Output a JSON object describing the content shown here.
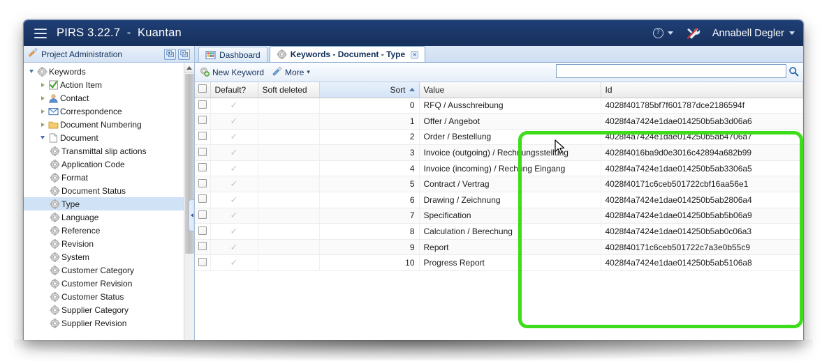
{
  "window": {
    "title_bar": {
      "menu_icon": "hamburger-icon",
      "app_title": "PIRS 3.22.7  -  Kuantan",
      "help_icon": "?",
      "tools_icon": "wrench-icon",
      "user_name": "Annabell Degler"
    }
  },
  "sidebar": {
    "header_title": "Project Administration",
    "header_buttons": [
      {
        "name": "expand-all-button",
        "icon": "expand-icon"
      },
      {
        "name": "collapse-all-button",
        "icon": "collapse-icon"
      }
    ],
    "tree": [
      {
        "label": "Keywords",
        "indent": 0,
        "twisty": "down",
        "icon": "gear-icon",
        "selected": false
      },
      {
        "label": "Action Item",
        "indent": 1,
        "twisty": "right",
        "icon": "check-icon",
        "selected": false
      },
      {
        "label": "Contact",
        "indent": 1,
        "twisty": "right",
        "icon": "contact-icon",
        "selected": false
      },
      {
        "label": "Correspondence",
        "indent": 1,
        "twisty": "right",
        "icon": "envelope-icon",
        "selected": false
      },
      {
        "label": "Document Numbering",
        "indent": 1,
        "twisty": "right",
        "icon": "folder-icon",
        "selected": false
      },
      {
        "label": "Document",
        "indent": 1,
        "twisty": "down",
        "icon": "page-icon",
        "selected": false
      },
      {
        "label": "Transmittal slip actions",
        "indent": 2,
        "twisty": "none",
        "icon": "gear-icon",
        "selected": false
      },
      {
        "label": "Application Code",
        "indent": 2,
        "twisty": "none",
        "icon": "gear-icon",
        "selected": false
      },
      {
        "label": "Format",
        "indent": 2,
        "twisty": "none",
        "icon": "gear-icon",
        "selected": false
      },
      {
        "label": "Document Status",
        "indent": 2,
        "twisty": "none",
        "icon": "gear-icon",
        "selected": false
      },
      {
        "label": "Type",
        "indent": 2,
        "twisty": "none",
        "icon": "gear-icon",
        "selected": true
      },
      {
        "label": "Language",
        "indent": 2,
        "twisty": "none",
        "icon": "gear-icon",
        "selected": false
      },
      {
        "label": "Reference",
        "indent": 2,
        "twisty": "none",
        "icon": "gear-icon",
        "selected": false
      },
      {
        "label": "Revision",
        "indent": 2,
        "twisty": "none",
        "icon": "gear-icon",
        "selected": false
      },
      {
        "label": "System",
        "indent": 2,
        "twisty": "none",
        "icon": "gear-icon",
        "selected": false
      },
      {
        "label": "Customer Category",
        "indent": 2,
        "twisty": "none",
        "icon": "gear-icon",
        "selected": false
      },
      {
        "label": "Customer Revision",
        "indent": 2,
        "twisty": "none",
        "icon": "gear-icon",
        "selected": false
      },
      {
        "label": "Customer Status",
        "indent": 2,
        "twisty": "none",
        "icon": "gear-icon",
        "selected": false
      },
      {
        "label": "Supplier Category",
        "indent": 2,
        "twisty": "none",
        "icon": "gear-icon",
        "selected": false
      },
      {
        "label": "Supplier Revision",
        "indent": 2,
        "twisty": "none",
        "icon": "gear-icon",
        "selected": false
      }
    ]
  },
  "tabs": [
    {
      "label": "Dashboard",
      "icon": "dashboard-icon",
      "active": false,
      "closable": false
    },
    {
      "label": "Keywords - Document - Type",
      "icon": "gear-icon",
      "active": true,
      "closable": true,
      "close_glyph": "×"
    }
  ],
  "toolbar": {
    "new_keyword_label": "New Keyword",
    "more_label": "More",
    "more_caret": "▾"
  },
  "search": {
    "value": "",
    "placeholder": "",
    "icon": "search-icon"
  },
  "grid": {
    "columns": [
      {
        "key": "checkbox",
        "label": "",
        "sorted": false,
        "align": "left"
      },
      {
        "key": "default",
        "label": "Default?",
        "sorted": false,
        "align": "left"
      },
      {
        "key": "softdeleted",
        "label": "Soft deleted",
        "sorted": false,
        "align": "left"
      },
      {
        "key": "sort",
        "label": "Sort",
        "sorted": true,
        "align": "right",
        "sort_dir": "asc"
      },
      {
        "key": "value",
        "label": "Value",
        "sorted": false,
        "align": "left"
      },
      {
        "key": "id",
        "label": "Id",
        "sorted": false,
        "align": "left"
      }
    ],
    "check_glyph": "✓",
    "rows": [
      {
        "sort": "0",
        "value": "RFQ / Ausschreibung",
        "id": "4028f401785bf7f601787dce2186594f",
        "default": true,
        "soft_deleted": ""
      },
      {
        "sort": "1",
        "value": "Offer / Angebot",
        "id": "4028f4a7424e1dae014250b5ab3d06a6",
        "default": true,
        "soft_deleted": ""
      },
      {
        "sort": "2",
        "value": "Order / Bestellung",
        "id": "4028f4a7424e1dae014250b5ab4706a7",
        "default": true,
        "soft_deleted": ""
      },
      {
        "sort": "3",
        "value": "Invoice (outgoing) / Rechnungsstellung",
        "id": "4028f4016ba9d0e3016c42894a682b99",
        "default": true,
        "soft_deleted": ""
      },
      {
        "sort": "4",
        "value": "Invoice (incoming) / Rechung Eingang",
        "id": "4028f4a7424e1dae014250b5ab3306a5",
        "default": true,
        "soft_deleted": ""
      },
      {
        "sort": "5",
        "value": "Contract / Vertrag",
        "id": "4028f40171c6ceb501722cbf16aa56e1",
        "default": true,
        "soft_deleted": ""
      },
      {
        "sort": "6",
        "value": "Drawing / Zeichnung",
        "id": "4028f4a7424e1dae014250b5ab2806a4",
        "default": true,
        "soft_deleted": ""
      },
      {
        "sort": "7",
        "value": "Specification",
        "id": "4028f4a7424e1dae014250b5ab5b06a9",
        "default": true,
        "soft_deleted": ""
      },
      {
        "sort": "8",
        "value": "Calculation / Berechung",
        "id": "4028f4a7424e1dae014250b5ab0c06a3",
        "default": true,
        "soft_deleted": ""
      },
      {
        "sort": "9",
        "value": "Report",
        "id": "4028f40171c6ceb501722c7a3e0b55c9",
        "default": true,
        "soft_deleted": ""
      },
      {
        "sort": "10",
        "value": "Progress Report",
        "id": "4028f4a7424e1dae014250b5ab5106a8",
        "default": true,
        "soft_deleted": ""
      }
    ]
  },
  "annotation": {
    "highlight_color": "#3ddd1b",
    "shape": "rounded-rectangle"
  },
  "colors": {
    "title_bar": "#1b3768",
    "selection": "#cfe2f6",
    "accent": "#16325c"
  }
}
